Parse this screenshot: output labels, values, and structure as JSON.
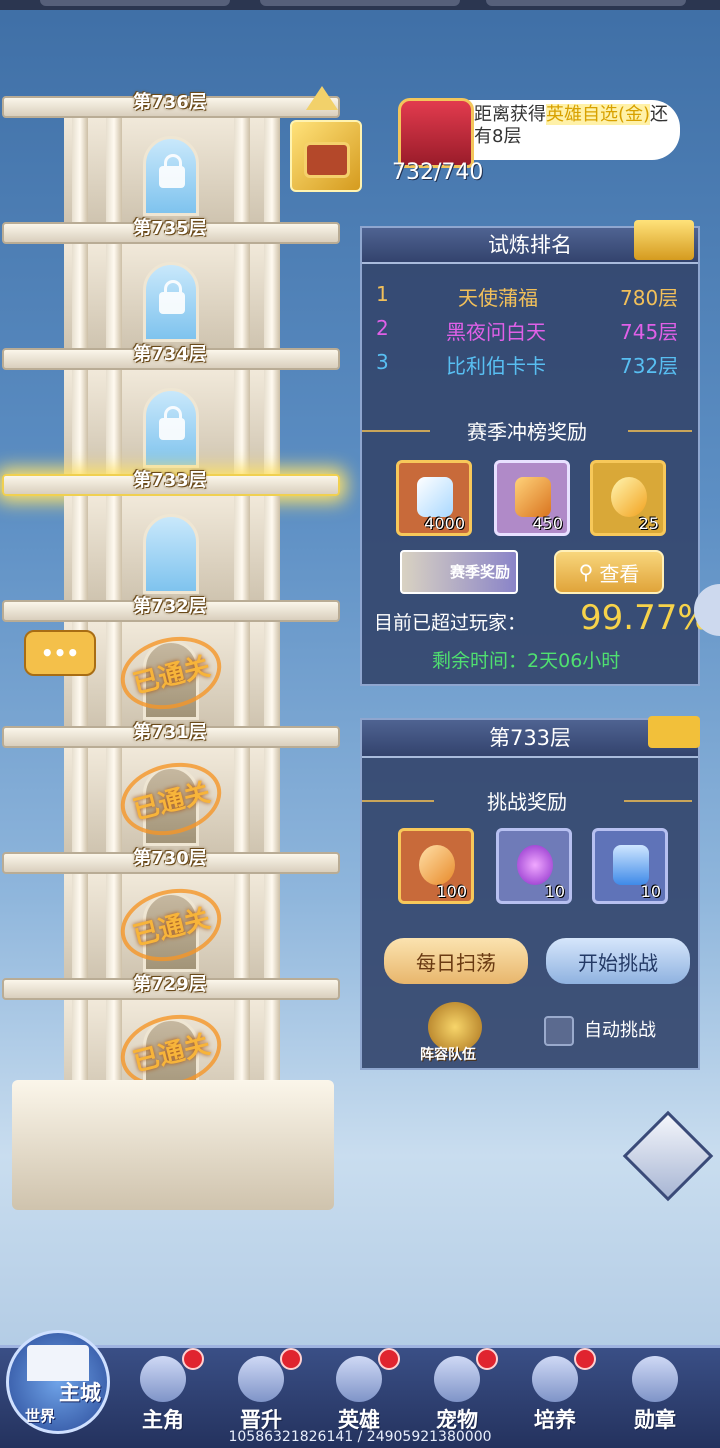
{
  "tower": {
    "floors": [
      {
        "label": "第736层",
        "state": "locked"
      },
      {
        "label": "第735层",
        "state": "locked"
      },
      {
        "label": "第734层",
        "state": "locked"
      },
      {
        "label": "第733层",
        "state": "current"
      },
      {
        "label": "第732层",
        "state": "cleared"
      },
      {
        "label": "第731层",
        "state": "cleared"
      },
      {
        "label": "第730层",
        "state": "cleared"
      },
      {
        "label": "第729层",
        "state": "cleared"
      }
    ],
    "cleared_stamp": "已通关",
    "chat_bubble": "•••"
  },
  "progress": {
    "text_prefix": "距离获得",
    "text_highlight": "英雄自选(金)",
    "text_suffix": "还有8层",
    "count": "732/740"
  },
  "ranking": {
    "title": "试炼排名",
    "rows": [
      {
        "rank": "1",
        "name": "天使蒲福",
        "floor": "780层",
        "color": "#f2c05a"
      },
      {
        "rank": "2",
        "name": "黑夜问白天",
        "floor": "745层",
        "color": "#e060e8"
      },
      {
        "rank": "3",
        "name": "比利伯卡卡",
        "floor": "732层",
        "color": "#58bff2"
      }
    ],
    "season_title": "赛季冲榜奖励",
    "rewards": [
      {
        "icon": "diamond-icon",
        "count": "4000"
      },
      {
        "icon": "crystal-icon",
        "count": "450"
      },
      {
        "icon": "flame-icon",
        "count": "25"
      }
    ],
    "season_badge": "赛季奖励",
    "view_button": "查看",
    "surpass_label": "目前已超过玩家：",
    "surpass_value": "99.77%",
    "remaining_label": "剩余时间：",
    "remaining_value": "2天06小时"
  },
  "floor_panel": {
    "title": "第733层",
    "rewards_title": "挑战奖励",
    "rewards": [
      {
        "icon": "skull-flame-icon",
        "count": "100"
      },
      {
        "icon": "purple-orb-icon",
        "count": "10"
      },
      {
        "icon": "potion-icon",
        "count": "10"
      }
    ],
    "sweep_button": "每日扫荡",
    "challenge_button": "开始挑战",
    "team_label": "阵容队伍",
    "auto_label": "自动挑战"
  },
  "nav": {
    "main": {
      "top": "主城",
      "bottom": "世界"
    },
    "items": [
      {
        "label": "主角"
      },
      {
        "label": "晋升"
      },
      {
        "label": "英雄"
      },
      {
        "label": "宠物"
      },
      {
        "label": "培养"
      },
      {
        "label": "勋章"
      }
    ]
  },
  "footer": "10586321826141 / 24905921380000",
  "colors": {
    "gold": "#f7c83f",
    "panel": "#34466e",
    "accent_green": "#4fe070"
  }
}
